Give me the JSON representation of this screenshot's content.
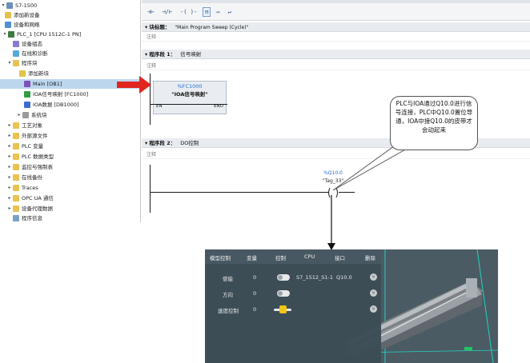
{
  "tree": {
    "root": "S7-1500",
    "add_device": "添加新设备",
    "devices_networks": "设备和网络",
    "plc": "PLC_1 [CPU 1512C-1 PN]",
    "device_config": "设备组态",
    "online_diag": "在线和诊断",
    "program_blocks": "程序块",
    "add_block": "添加新块",
    "main_ob": "Main [OB1]",
    "fc_block": "IOA信号映射 [FC1000]",
    "db_block": "IOA数据 [DB1000]",
    "system_blocks": "系统块",
    "tech_objects": "工艺对象",
    "external_sources": "外部源文件",
    "plc_tags": "PLC 变量",
    "plc_types": "PLC 数据类型",
    "watch_force": "监控与强制表",
    "online_backup": "在线备份",
    "traces": "Traces",
    "opcua": "OPC UA 通信",
    "proxy": "设备代理数据",
    "program_info": "程序信息"
  },
  "toolbar": {
    "b1": "⊣⊢",
    "b2": "⊣/⊢",
    "b3": "-( )-",
    "b4": "⊟",
    "b5": "↦",
    "b6": "↵"
  },
  "block": {
    "title_label": "块标题：",
    "title_value": "\"Main Program Sweep (Cycle)\"",
    "comment": "注释"
  },
  "network1": {
    "label": "程序段 1：",
    "name": "信号映射",
    "comment": "注释",
    "fc_tag": "%FC1000",
    "fc_name": "\"IOA信号映射\"",
    "en": "EN",
    "eno": "ENO"
  },
  "network2": {
    "label": "程序段 2：",
    "name": "DO控制",
    "comment": "注释",
    "coil_addr": "%Q10.0",
    "coil_tag": "\"Tag_33\""
  },
  "callout": {
    "text": "PLC与IOA通过Q10.0进行信号连接，PLC中Q10.0置位导通，IOA中接Q10.0的皮带才会动起来"
  },
  "sim": {
    "headers": {
      "model": "模型控制",
      "variable": "变量",
      "control": "控制",
      "cpu": "CPU",
      "interface": "接口",
      "delete": "删除"
    },
    "rows": [
      {
        "label": "使能",
        "value": "0",
        "cpu": "S7_1512_S1-1",
        "interface": "Q10.0"
      },
      {
        "label": "方向",
        "value": "0",
        "cpu": "",
        "interface": ""
      },
      {
        "label": "速度控制",
        "value": "0",
        "cpu": "",
        "interface": ""
      }
    ],
    "delete_glyph": "×"
  },
  "colors": {
    "selection": "#bcd6ee",
    "arrow_red": "#e0261e",
    "tag_blue": "#2a6bd0",
    "panel": "#3c4c56",
    "grid_cyan": "#22d3c5"
  }
}
